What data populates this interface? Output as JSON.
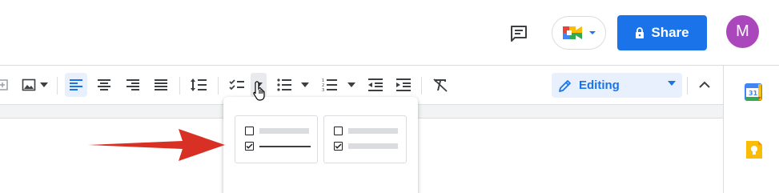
{
  "header": {
    "share_label": "Share",
    "avatar_letter": "M"
  },
  "toolbar": {
    "editing_mode": "Editing",
    "icons": [
      "insert-link-icon",
      "insert-image-icon",
      "align-left-icon",
      "align-center-icon",
      "align-right-icon",
      "justify-icon",
      "line-spacing-icon",
      "checklist-icon",
      "bulleted-list-icon",
      "numbered-list-icon",
      "decrease-indent-icon",
      "increase-indent-icon",
      "clear-formatting-icon"
    ],
    "active_alignment": "left"
  },
  "checklist_menu": {
    "options": [
      {
        "name": "checklist-strikethrough",
        "rows": [
          "unchecked",
          "checked-strikethrough"
        ]
      },
      {
        "name": "checklist-no-strikethrough",
        "rows": [
          "unchecked",
          "checked"
        ]
      }
    ]
  },
  "side_panel": {
    "items": [
      "calendar-icon",
      "keep-icon"
    ]
  },
  "colors": {
    "accent": "#1a73e8",
    "avatar": "#ab47bc",
    "arrow": "#d93025"
  }
}
